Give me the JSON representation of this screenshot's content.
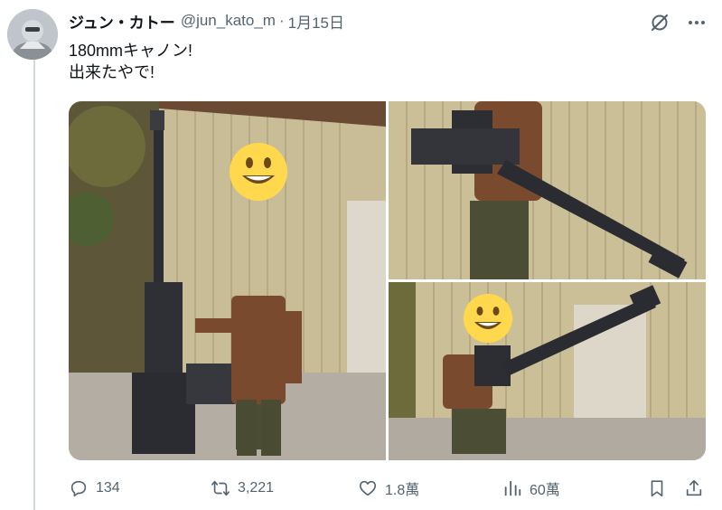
{
  "tweet": {
    "author_name": "ジュン・カトー",
    "handle": "@jun_kato_m",
    "separator": "·",
    "date": "1月15日",
    "text_line1": "180mmキャノン!",
    "text_line2": "出来たやで!"
  },
  "media": {
    "photos": [
      {
        "name": "photo-standing-with-cannon"
      },
      {
        "name": "photo-holding-cannon"
      },
      {
        "name": "photo-kneeling-with-cannon"
      }
    ]
  },
  "actions": {
    "reply_count": "134",
    "repost_count": "3,221",
    "like_count": "1.8萬",
    "view_count": "60萬"
  },
  "colors": {
    "text": "#0f1419",
    "secondary": "#536471",
    "divider": "#cfd9de"
  },
  "icons": [
    "grok-icon",
    "more-icon",
    "reply-icon",
    "repost-icon",
    "like-icon",
    "views-icon",
    "bookmark-icon",
    "share-icon"
  ]
}
